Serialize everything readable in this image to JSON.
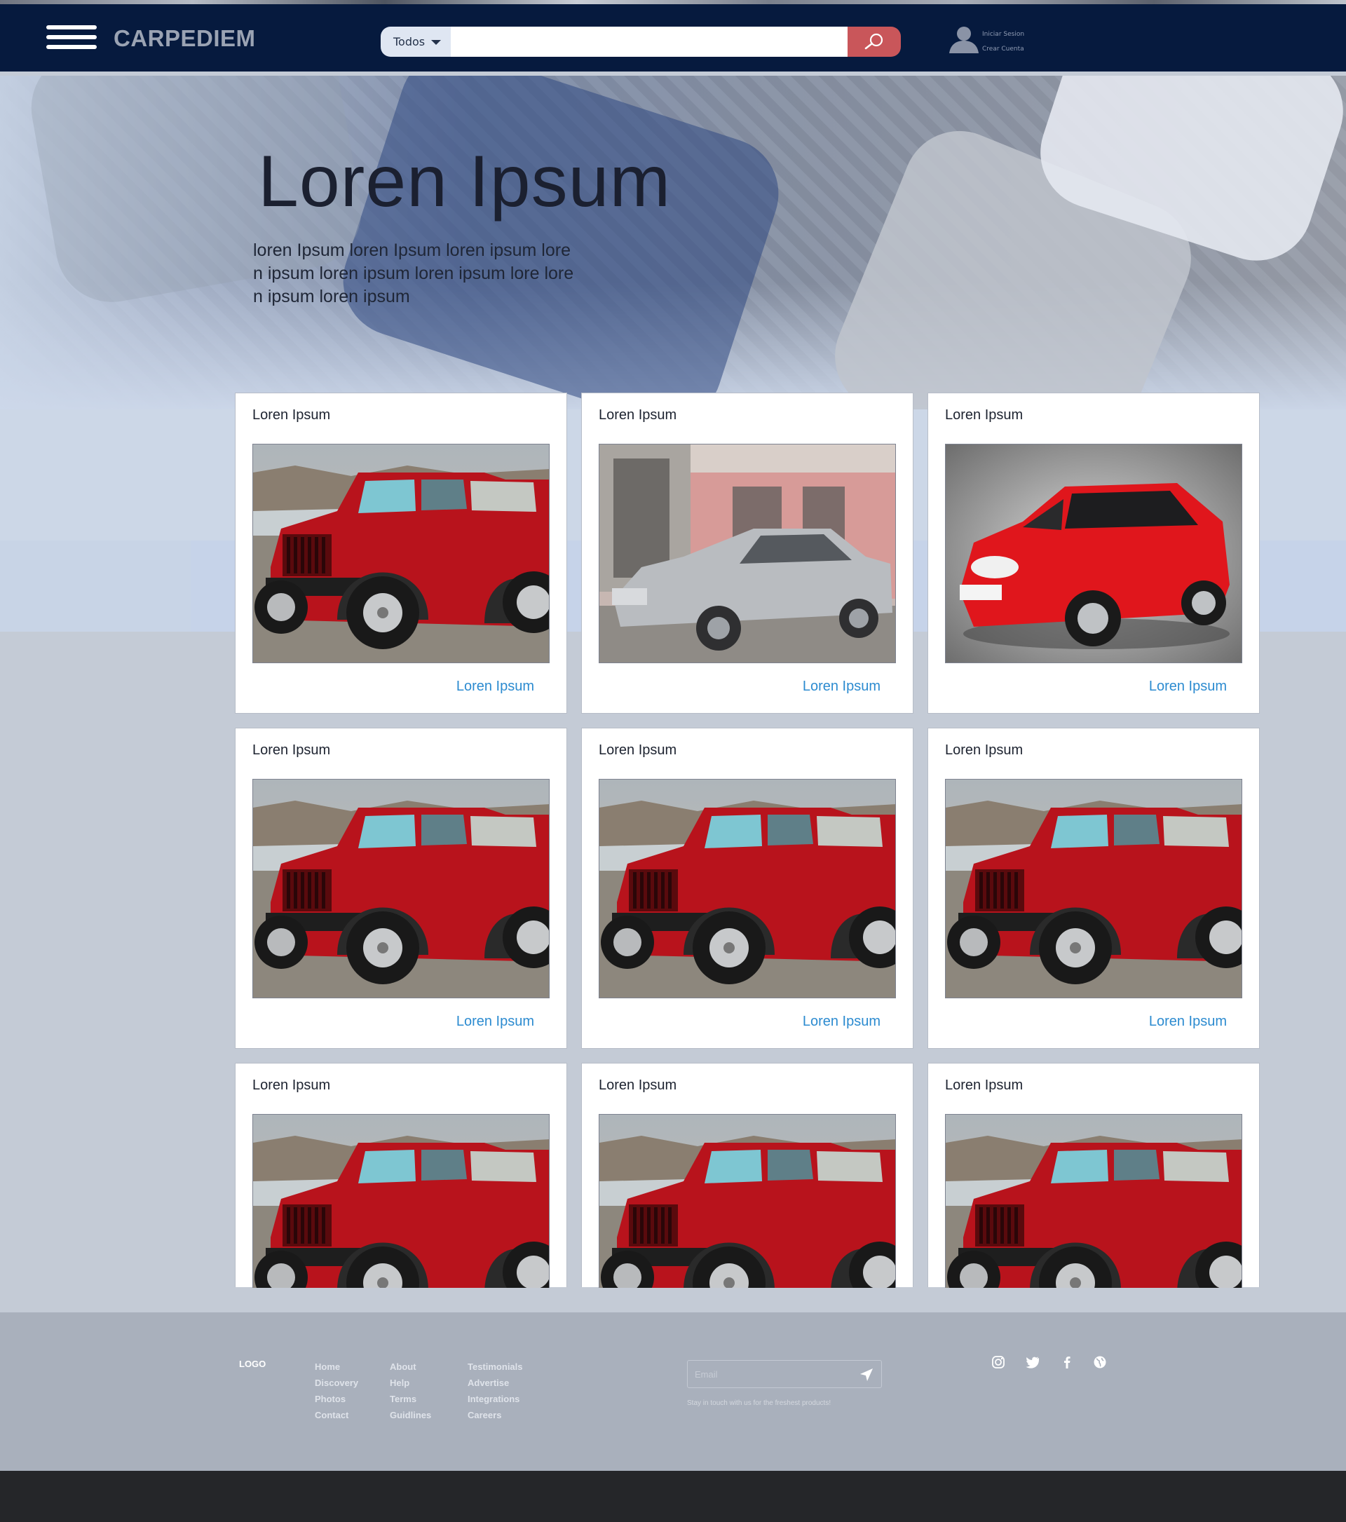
{
  "header": {
    "brand": "CARPEDIEM",
    "search": {
      "category": "Todos",
      "placeholder": ""
    },
    "user_links": [
      "Iniciar Sesion",
      "Crear Cuenta"
    ]
  },
  "hero": {
    "title": "Loren Ipsum",
    "text": "loren Ipsum loren Ipsum loren ipsum loren ipsum loren ipsum loren ipsum lore loren ipsum loren ipsum"
  },
  "cards": [
    {
      "title": "Loren Ipsum",
      "link": "Loren Ipsum",
      "image": "red-jeep"
    },
    {
      "title": "Loren Ipsum",
      "link": "Loren Ipsum",
      "image": "silver-sedan"
    },
    {
      "title": "Loren Ipsum",
      "link": "Loren Ipsum",
      "image": "red-hatchback"
    },
    {
      "title": "Loren Ipsum",
      "link": "Loren Ipsum",
      "image": "red-jeep"
    },
    {
      "title": "Loren Ipsum",
      "link": "Loren Ipsum",
      "image": "red-jeep"
    },
    {
      "title": "Loren Ipsum",
      "link": "Loren Ipsum",
      "image": "red-jeep"
    },
    {
      "title": "Loren Ipsum",
      "image": "red-jeep"
    },
    {
      "title": "Loren Ipsum",
      "image": "red-jeep"
    },
    {
      "title": "Loren Ipsum",
      "image": "red-jeep"
    }
  ],
  "footer": {
    "logo": "LOGO",
    "columns": [
      [
        "Home",
        "Discovery",
        "Photos",
        "Contact"
      ],
      [
        "About",
        "Help",
        "Terms",
        "Guidlines"
      ],
      [
        "Testimonials",
        "Advertise",
        "Integrations",
        "Careers"
      ]
    ],
    "email_placeholder": "Email",
    "tagline": "Stay in touch with us for the freshest products!",
    "social": [
      "instagram-icon",
      "twitter-icon",
      "facebook-icon",
      "globe-icon"
    ]
  },
  "colors": {
    "header_bg": "#061a3e",
    "search_button": "#c9565a",
    "link": "#2c8bd0",
    "footer_bg": "#a9b0bc",
    "bottom_bar": "#252629"
  }
}
